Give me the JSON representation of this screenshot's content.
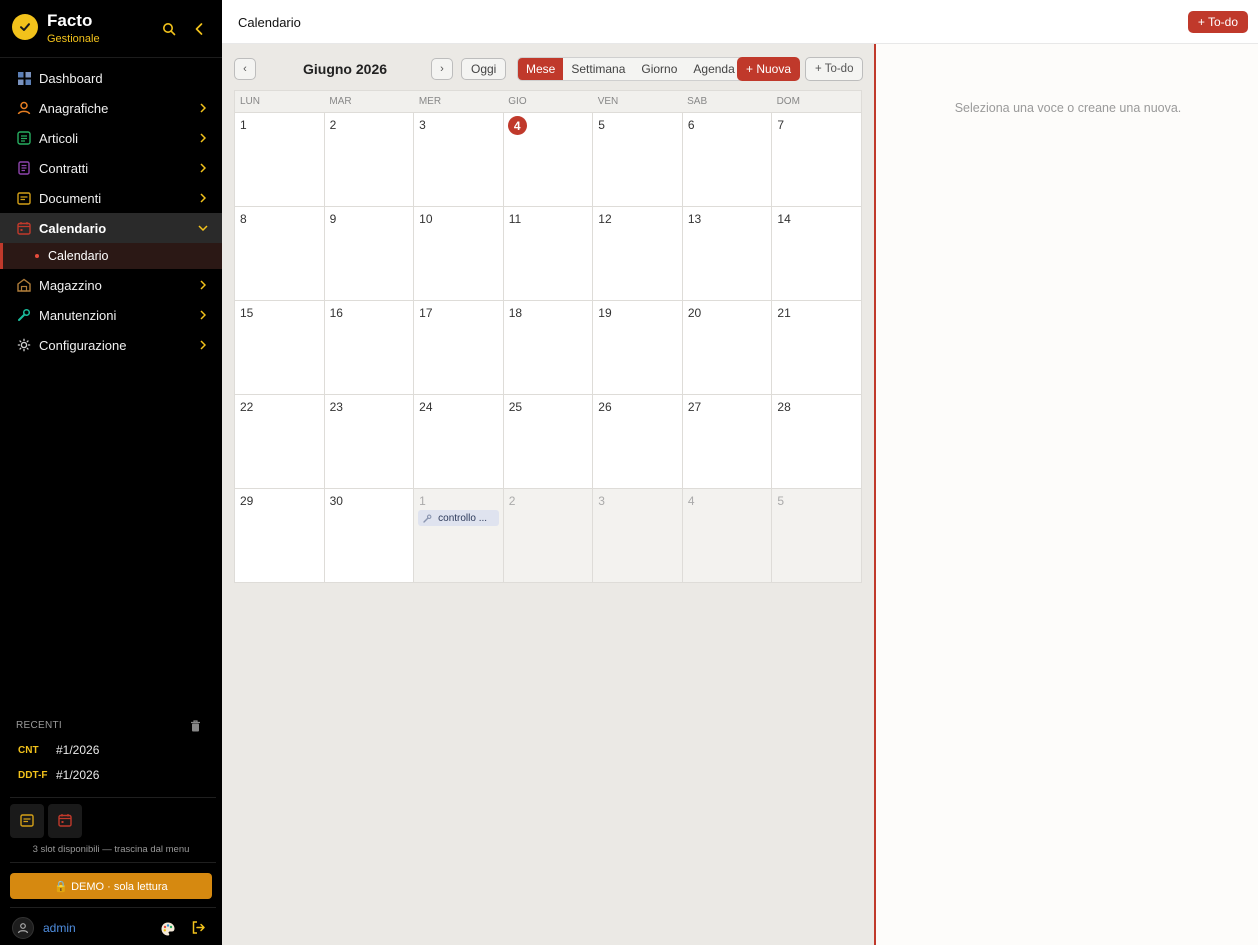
{
  "brand": {
    "name": "Facto",
    "subtitle": "Gestionale"
  },
  "nav": [
    {
      "label": "Dashboard",
      "icon": "dashboard-icon",
      "color": "#5b7fb6",
      "chevron": false
    },
    {
      "label": "Anagrafiche",
      "icon": "user-icon",
      "color": "#e67e22",
      "chevron": true
    },
    {
      "label": "Articoli",
      "icon": "list-icon",
      "color": "#27ae60",
      "chevron": true
    },
    {
      "label": "Contratti",
      "icon": "document-icon",
      "color": "#8e44ad",
      "chevron": true
    },
    {
      "label": "Documenti",
      "icon": "folder-doc-icon",
      "color": "#d4a017",
      "chevron": true
    },
    {
      "label": "Calendario",
      "icon": "calendar-icon",
      "color": "#c0392b",
      "chevron": true,
      "active": true
    },
    {
      "label": "Magazzino",
      "icon": "warehouse-icon",
      "color": "#b07d3a",
      "chevron": true
    },
    {
      "label": "Manutenzioni",
      "icon": "wrench-icon",
      "color": "#1abc9c",
      "chevron": true
    },
    {
      "label": "Configurazione",
      "icon": "gear-icon",
      "color": "#cfcfcf",
      "chevron": true
    }
  ],
  "nav_sub": {
    "label": "Calendario"
  },
  "recent": {
    "title": "RECENTI",
    "items": [
      {
        "tag": "CNT",
        "ref": "#1/2026"
      },
      {
        "tag": "DDT-F",
        "ref": "#1/2026"
      }
    ]
  },
  "slots": {
    "note": "3 slot disponibili — trascina dal menu"
  },
  "demo": {
    "label": "🔒 DEMO · sola lettura"
  },
  "user": {
    "name": "admin"
  },
  "header": {
    "title": "Calendario",
    "todo_label": "+ To-do"
  },
  "toolbar": {
    "prev": "‹",
    "next": "›",
    "month": "Giugno 2026",
    "today": "Oggi",
    "views": [
      "Mese",
      "Settimana",
      "Giorno",
      "Agenda"
    ],
    "active_view": "Mese",
    "new_label": "+ Nuova",
    "todo_label": "+ To-do"
  },
  "calendar": {
    "weekdays": [
      "LUN",
      "MAR",
      "MER",
      "GIO",
      "VEN",
      "SAB",
      "DOM"
    ],
    "today": 4,
    "weeks": [
      [
        1,
        2,
        3,
        4,
        5,
        6,
        7
      ],
      [
        8,
        9,
        10,
        11,
        12,
        13,
        14
      ],
      [
        15,
        16,
        17,
        18,
        19,
        20,
        21
      ],
      [
        22,
        23,
        24,
        25,
        26,
        27,
        28
      ],
      [
        29,
        30,
        1,
        2,
        3,
        4,
        5
      ]
    ],
    "event": {
      "label": "controllo ...",
      "week": 4,
      "day": 2
    }
  },
  "right_panel": {
    "empty": "Seleziona una voce o creane una nuova."
  },
  "colors": {
    "accent": "#c0392b",
    "brand": "#f2c21b",
    "demo": "#d68910"
  }
}
